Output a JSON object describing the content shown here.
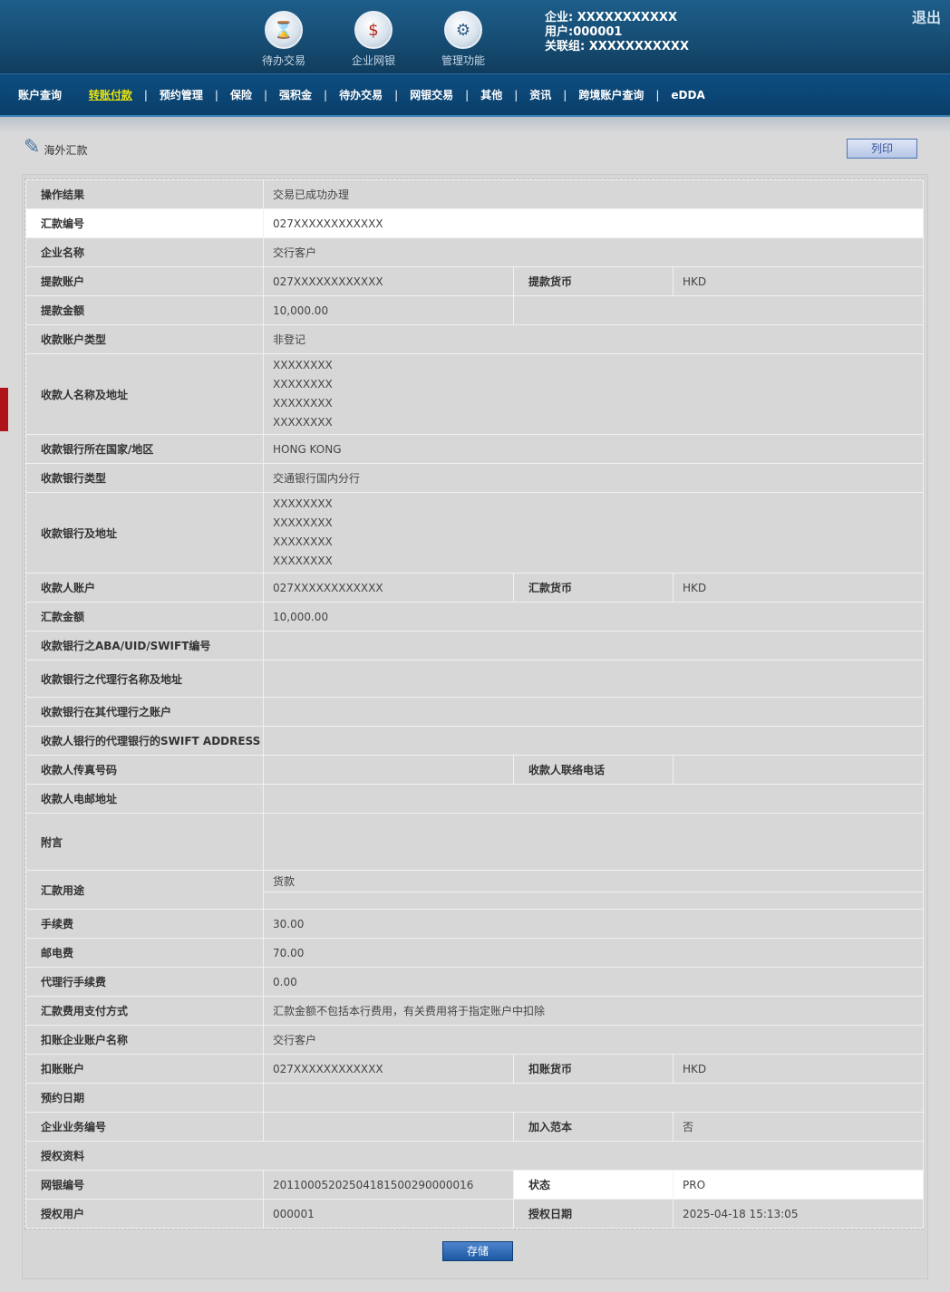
{
  "header": {
    "icons": [
      {
        "label": "待办交易",
        "icon": "pending-transactions-icon"
      },
      {
        "label": "企业网银",
        "icon": "corporate-banking-icon"
      },
      {
        "label": "管理功能",
        "icon": "management-gear-icon"
      }
    ],
    "company": "企业: XXXXXXXXXXX",
    "user": "用户:000001",
    "group": "关联组: XXXXXXXXXXX",
    "logout": "退出"
  },
  "nav": {
    "items": [
      "账户查询",
      "转账付款",
      "预约管理",
      "保险",
      "强积金",
      "待办交易",
      "网银交易",
      "其他",
      "资讯",
      "跨境账户查询",
      "eDDA"
    ],
    "active_index": 1
  },
  "page": {
    "title": "海外汇款",
    "print_label": "列印",
    "save_label": "存储"
  },
  "rows": {
    "op_result": {
      "label": "操作结果",
      "value": "交易已成功办理"
    },
    "remit_no": {
      "label": "汇款编号",
      "value": "027XXXXXXXXXXXX"
    },
    "company_name": {
      "label": "企业名称",
      "value": "交行客户"
    },
    "debit_account": {
      "label": "提款账户",
      "value": "027XXXXXXXXXXXX",
      "label2": "提款货币",
      "value2": "HKD"
    },
    "debit_amount": {
      "label": "提款金额",
      "value": "10,000.00"
    },
    "payee_acct_type": {
      "label": "收款账户类型",
      "value": "非登记"
    },
    "payee_name_addr": {
      "label": "收款人名称及地址",
      "lines": [
        "XXXXXXXX",
        "XXXXXXXX",
        "XXXXXXXX",
        "XXXXXXXX"
      ]
    },
    "bank_country": {
      "label": "收款银行所在国家/地区",
      "value": "HONG KONG"
    },
    "bank_type": {
      "label": "收款银行类型",
      "value": "交通银行国内分行"
    },
    "bank_addr": {
      "label": "收款银行及地址",
      "lines": [
        "XXXXXXXX",
        "XXXXXXXX",
        "XXXXXXXX",
        "XXXXXXXX"
      ]
    },
    "payee_account": {
      "label": "收款人账户",
      "value": "027XXXXXXXXXXXX",
      "label2": "汇款货币",
      "value2": "HKD"
    },
    "remit_amount": {
      "label": "汇款金额",
      "value": "10,000.00"
    },
    "aba": {
      "label": "收款银行之ABA/UID/SWIFT编号",
      "value": ""
    },
    "agent_bank": {
      "label": "收款银行之代理行名称及地址",
      "value": ""
    },
    "agent_account": {
      "label": "收款银行在其代理行之账户",
      "value": ""
    },
    "agent_swift": {
      "label": "收款人银行的代理银行的SWIFT ADDRESS",
      "value": ""
    },
    "fax": {
      "label": "收款人传真号码",
      "value": "",
      "label2": "收款人联络电话",
      "value2": ""
    },
    "email": {
      "label": "收款人电邮地址",
      "value": ""
    },
    "remark": {
      "label": "附言",
      "value": ""
    },
    "purpose": {
      "label": "汇款用途",
      "value": "货款"
    },
    "fee": {
      "label": "手续费",
      "value": "30.00"
    },
    "postage": {
      "label": "邮电费",
      "value": "70.00"
    },
    "agent_fee": {
      "label": "代理行手续费",
      "value": "0.00"
    },
    "fee_method": {
      "label": "汇款费用支付方式",
      "value": "汇款金额不包括本行费用，有关费用将于指定账户中扣除"
    },
    "debit_company": {
      "label": "扣账企业账户名称",
      "value": "交行客户"
    },
    "debit_acct2": {
      "label": "扣账账户",
      "value": "027XXXXXXXXXXXX",
      "label2": "扣账货币",
      "value2": "HKD"
    },
    "appt_date": {
      "label": "预约日期",
      "value": ""
    },
    "biz_no": {
      "label": "企业业务编号",
      "value": "",
      "label2": "加入范本",
      "value2": "否"
    },
    "auth_info": {
      "label": "授权资料"
    },
    "ebank_no": {
      "label": "网银编号",
      "value": "20110005202504181500290000016",
      "label2": "状态",
      "value2": "PRO"
    },
    "auth_user": {
      "label": "授权用户",
      "value": "000001",
      "label2": "授权日期",
      "value2": "2025-04-18 15:13:05"
    }
  }
}
